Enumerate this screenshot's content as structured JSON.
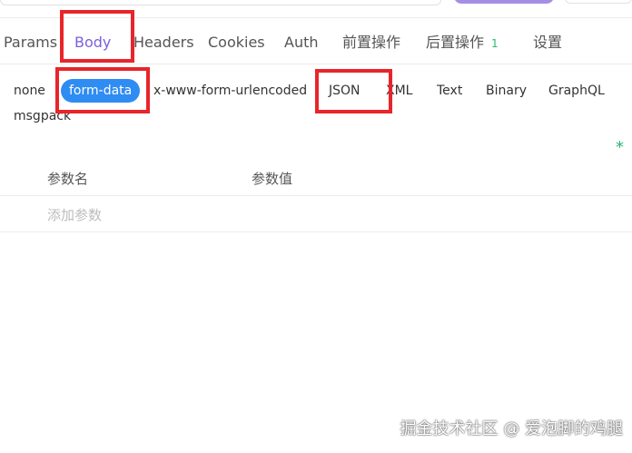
{
  "request_tabs": {
    "params": "Params",
    "body": "Body",
    "headers": "Headers",
    "cookies": "Cookies",
    "auth": "Auth",
    "pre_ops": "前置操作",
    "post_ops": "后置操作",
    "post_ops_count": "1",
    "settings": "设置",
    "active": "Body"
  },
  "body_types": {
    "none": "none",
    "form_data": "form-data",
    "urlencoded": "x-www-form-urlencoded",
    "json": "JSON",
    "xml": "XML",
    "text": "Text",
    "binary": "Binary",
    "graphql": "GraphQL",
    "msgpack": "msgpack",
    "selected": "form-data"
  },
  "required_marker": "*",
  "params_table": {
    "name_header": "参数名",
    "value_header": "参数值",
    "add_placeholder": "添加参数"
  },
  "watermark": "掘金技术社区 @ 爱泡脚的鸡腿",
  "colors": {
    "active_tab": "#7b61d9",
    "selected_chip": "#2f8cf2",
    "annotation": "#e8252a",
    "badge": "#2bb673"
  }
}
